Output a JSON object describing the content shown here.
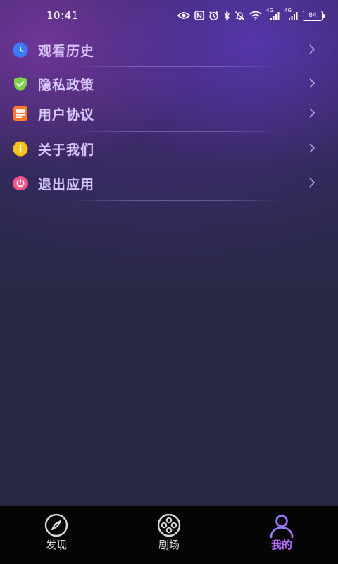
{
  "status_bar": {
    "time": "10:41",
    "network_left": "4G",
    "network_right": "4G",
    "battery": "84"
  },
  "menu": {
    "items": [
      {
        "label": "观看历史",
        "icon": "clock-icon",
        "color": "#3d7bff"
      },
      {
        "label": "隐私政策",
        "icon": "shield-check-icon",
        "color": "#7ed04a"
      },
      {
        "label": "用户协议",
        "icon": "document-icon",
        "color": "#ff7a2a"
      },
      {
        "label": "关于我们",
        "icon": "info-icon",
        "color": "#f4c21a"
      },
      {
        "label": "退出应用",
        "icon": "power-icon",
        "color": "#f0558a"
      }
    ],
    "chevron": ">"
  },
  "bottom_nav": {
    "items": [
      {
        "label": "发现",
        "icon": "compass-icon",
        "active": false
      },
      {
        "label": "剧场",
        "icon": "film-reel-icon",
        "active": false
      },
      {
        "label": "我的",
        "icon": "user-icon",
        "active": true
      }
    ],
    "active_color": "#b86cff"
  }
}
